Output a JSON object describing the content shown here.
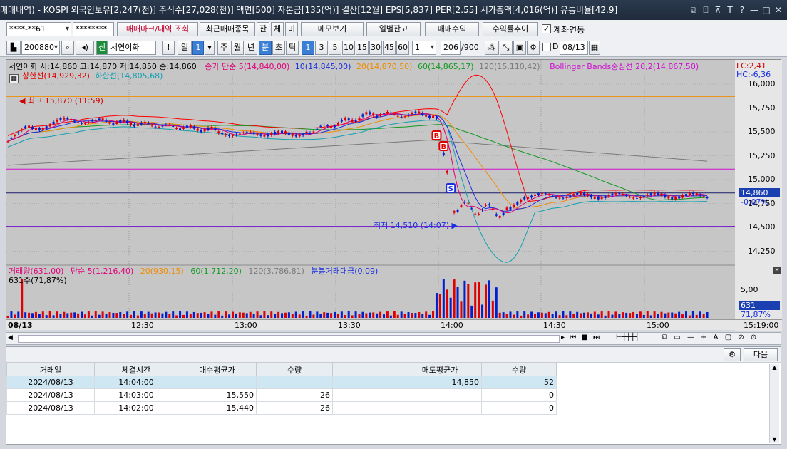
{
  "title": {
    "text": "매매내역) - KOSPI 외국인보유[2,247(천)] 주식수[27,028(천)] 액면[500] 자본금[135(억)] 결산[12월] EPS[5,837] PER[2.55] 시가총액[4,016(억)] 유통비율[42.9]",
    "icons": [
      "⧉",
      "⍐",
      "⊼",
      "T",
      "?",
      "—",
      "□",
      "✕"
    ]
  },
  "toolbar1": {
    "account": "****-**61",
    "password": "********",
    "mark_btn": "매매마크/내역 조회",
    "recent_btn": "최근매매종목",
    "btn_jan": "잔",
    "btn_che": "체",
    "btn_mi": "미",
    "memo_btn": "메모보기",
    "daily_btn": "일별잔고",
    "trade_profit_btn": "매매수익",
    "profit_trend_btn": "수익률추이",
    "account_link_label": "계좌연동"
  },
  "toolbar2": {
    "code": "200880",
    "shin": "신",
    "name": "서연이화",
    "excl": "!",
    "period_day": "일",
    "period_num": "1",
    "ju": "주",
    "wol": "월",
    "nyeon": "년",
    "bun": "분",
    "cho": "초",
    "tik": "틱",
    "intervals": [
      "1",
      "3",
      "5",
      "10",
      "15",
      "30",
      "45",
      "60"
    ],
    "count": "1",
    "range": "206",
    "range_total": "/900",
    "d_label": "D",
    "date": "08/13"
  },
  "chart": {
    "stock_line": "서연이화 시:14,860 고:14,870 저:14,850 종:14,860",
    "ma_label": "종가 단순",
    "ma5": "5(14,840,00)",
    "ma10": "10(14,845,00)",
    "ma20": "20(14,870,50)",
    "ma60": "60(14,865,17)",
    "ma120": "120(15,110,42)",
    "bb": "Bollinger Bands중심선 20,2(14,867,50)",
    "upper_limit": "상한선(14,929,32)",
    "lower_limit": "하한선(14,805,68)",
    "lc": "LC:2,41",
    "hc": "HC:-6,36",
    "high_marker": "최고 15,870 (11:59)",
    "low_marker": "최저 14,510 (14:07)",
    "price_ticks": [
      "16,000",
      "15,750",
      "15,500",
      "15,250",
      "15,000",
      "14,750",
      "14,500",
      "14,250"
    ],
    "current_price": "14,860",
    "current_change": "-0.07%",
    "vol_label": "거래량(631,00)",
    "vol_ma5": "단순 5(1,216,40)",
    "vol_ma20": "20(930,15)",
    "vol_ma60": "60(1,712,20)",
    "vol_ma120": "120(3,786,81)",
    "vol_amount": "분봉거래대금(0,09)",
    "vol_sub": "631주(71,87%)",
    "vol_tick": "5,00",
    "vol_current": "631",
    "vol_pct": "71,87%",
    "date_label": "08/13",
    "time_ticks": [
      "12:30",
      "13:00",
      "13:30",
      "14:00",
      "14:30",
      "15:00"
    ],
    "last_time": "15:19:00",
    "marker_b": "B",
    "marker_s": "S"
  },
  "lower": {
    "next_btn": "다음",
    "headers": [
      "거래일",
      "체결시간",
      "매수평균가",
      "수량",
      "",
      "매도평균가",
      "수량"
    ],
    "rows": [
      [
        "2024/08/13",
        "14:04:00",
        "",
        "",
        "",
        "14,850",
        "52"
      ],
      [
        "2024/08/13",
        "14:03:00",
        "15,550",
        "26",
        "",
        "",
        "0"
      ],
      [
        "2024/08/13",
        "14:02:00",
        "15,440",
        "26",
        "",
        "",
        "0"
      ]
    ]
  },
  "colors": {
    "ma5": "#e0007a",
    "ma10": "#1a2fe0",
    "ma20": "#f08c00",
    "ma60": "#119a22",
    "ma120": "#7a7a7a",
    "bb": "#d010d0",
    "bb_band": "#ff0000",
    "bb_lower": "#10a0b0",
    "up": "#e00000",
    "down": "#0020d0"
  }
}
